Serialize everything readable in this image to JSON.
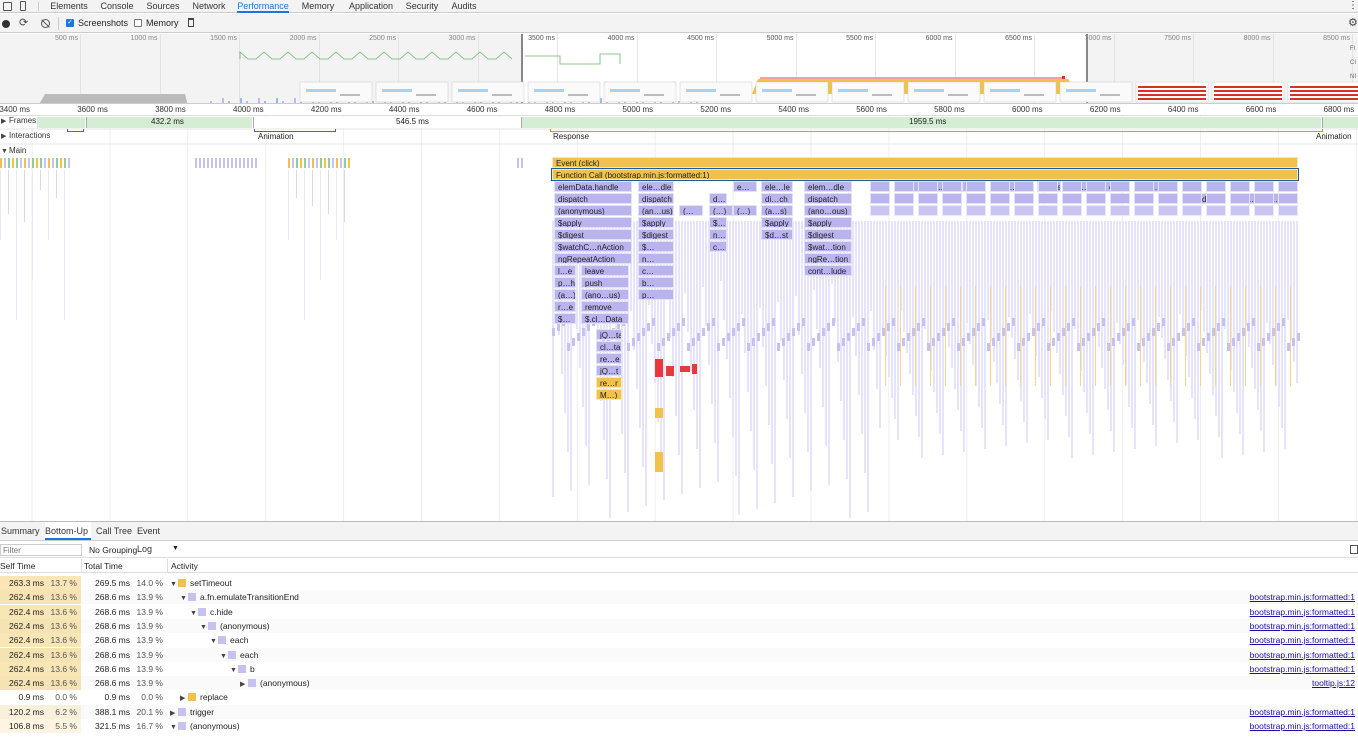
{
  "devtools": {
    "tabs": [
      "Elements",
      "Console",
      "Sources",
      "Network",
      "Performance",
      "Memory",
      "Application",
      "Security",
      "Audits"
    ],
    "active_tab": "Performance"
  },
  "toolbar": {
    "screenshots_label": "Screenshots",
    "screenshots_checked": true,
    "memory_label": "Memory",
    "memory_checked": false
  },
  "overview": {
    "ticks": [
      "500 ms",
      "1000 ms",
      "1500 ms",
      "2000 ms",
      "2500 ms",
      "3000 ms",
      "3500 ms",
      "4000 ms",
      "4500 ms",
      "5000 ms",
      "5500 ms",
      "6000 ms",
      "6500 ms",
      "7000 ms",
      "7500 ms",
      "8000 ms",
      "8500 ms"
    ],
    "side_labels": [
      "FI",
      "CI",
      "NI"
    ]
  },
  "ruler": {
    "ticks": [
      "3400 ms",
      "3600 ms",
      "3800 ms",
      "4000 ms",
      "4200 ms",
      "4400 ms",
      "4600 ms",
      "4800 ms",
      "5000 ms",
      "5200 ms",
      "5400 ms",
      "5600 ms",
      "5800 ms",
      "6000 ms",
      "6200 ms",
      "6400 ms",
      "6600 ms",
      "6800 ms"
    ]
  },
  "tracks": {
    "frames_label": "Frames",
    "frames_times": [
      "432.2 ms",
      "546.5 ms",
      "1959.5 ms"
    ],
    "interactions_label": "Interactions",
    "interactions": [
      "Animation",
      "Response",
      "Animation"
    ],
    "main_label": "Main"
  },
  "flame": {
    "event": "Event (click)",
    "function_call": "Function Call (bootstrap.min.js:formatted:1)",
    "col1": [
      "elemData.handle",
      "dispatch",
      "(anonymous)",
      "$apply",
      "$digest",
      "$watchC…nAction",
      "ngRepeatAction"
    ],
    "col1b": [
      "l…e",
      "p…h",
      "(a…)",
      "r…e",
      "$…"
    ],
    "col1c": [
      "leave",
      "push",
      "(ano…us)",
      "remove",
      "$.cl…Data"
    ],
    "col1d": [
      "jQ…ta",
      "cl…ta",
      "re…e",
      "jQ…t",
      "re…r",
      "M…)"
    ],
    "col2": [
      "ele…dle",
      "dispatch",
      "(an…us)",
      "$apply",
      "$digest",
      "$…",
      "n…",
      "c…",
      "b…",
      "p…"
    ],
    "col3": [
      "d…",
      "$…",
      "$…",
      "n…",
      "c…"
    ],
    "col4": [
      "ele…le",
      "di…ch",
      "(a…s)",
      "$apply",
      "$d…st"
    ],
    "col5": [
      "elem…dle",
      "dispatch",
      "(ano…ous)",
      "$apply",
      "$digest",
      "$wat…tion",
      "ngRe…tion",
      "cont…lude"
    ],
    "misc_labels": [
      "(…",
      "(…)",
      "(…)",
      "e…",
      "e…",
      "el…le",
      "e…",
      "e…",
      "el…le",
      "ele…",
      "e…",
      "e…",
      "d…",
      "d…h",
      "di…ch",
      "d…h",
      "di…ch",
      "di…ch",
      "d…h",
      "di…ch",
      "El…le"
    ]
  },
  "bottom": {
    "tabs": [
      "Summary",
      "Bottom-Up",
      "Call Tree",
      "Event Log"
    ],
    "active_tab": "Bottom-Up",
    "filter_placeholder": "Filter",
    "grouping": "No Grouping",
    "headers": {
      "self": "Self Time",
      "total": "Total Time",
      "activity": "Activity"
    },
    "rows": [
      {
        "self": "263.3 ms",
        "self_pct": "13.7 %",
        "total": "269.5 ms",
        "total_pct": "14.0 %",
        "indent": 0,
        "tri": "▼",
        "color": "#f0c14b",
        "name": "setTimeout",
        "link": "",
        "selfbar": 0.137
      },
      {
        "self": "262.4 ms",
        "self_pct": "13.6 %",
        "total": "268.6 ms",
        "total_pct": "13.9 %",
        "indent": 1,
        "tri": "▼",
        "color": "#c5c2f0",
        "name": "a.fn.emulateTransitionEnd",
        "link": "bootstrap.min.js:formatted:1",
        "selfbar": 0.136
      },
      {
        "self": "262.4 ms",
        "self_pct": "13.6 %",
        "total": "268.6 ms",
        "total_pct": "13.9 %",
        "indent": 2,
        "tri": "▼",
        "color": "#c5c2f0",
        "name": "c.hide",
        "link": "bootstrap.min.js:formatted:1",
        "selfbar": 0.136
      },
      {
        "self": "262.4 ms",
        "self_pct": "13.6 %",
        "total": "268.6 ms",
        "total_pct": "13.9 %",
        "indent": 3,
        "tri": "▼",
        "color": "#c5c2f0",
        "name": "(anonymous)",
        "link": "bootstrap.min.js:formatted:1",
        "selfbar": 0.136
      },
      {
        "self": "262.4 ms",
        "self_pct": "13.6 %",
        "total": "268.6 ms",
        "total_pct": "13.9 %",
        "indent": 4,
        "tri": "▼",
        "color": "#c5c2f0",
        "name": "each",
        "link": "bootstrap.min.js:formatted:1",
        "selfbar": 0.136
      },
      {
        "self": "262.4 ms",
        "self_pct": "13.6 %",
        "total": "268.6 ms",
        "total_pct": "13.9 %",
        "indent": 5,
        "tri": "▼",
        "color": "#c5c2f0",
        "name": "each",
        "link": "bootstrap.min.js:formatted:1",
        "selfbar": 0.136
      },
      {
        "self": "262.4 ms",
        "self_pct": "13.6 %",
        "total": "268.6 ms",
        "total_pct": "13.9 %",
        "indent": 6,
        "tri": "▼",
        "color": "#c5c2f0",
        "name": "b",
        "link": "bootstrap.min.js:formatted:1",
        "selfbar": 0.136
      },
      {
        "self": "262.4 ms",
        "self_pct": "13.6 %",
        "total": "268.6 ms",
        "total_pct": "13.9 %",
        "indent": 7,
        "tri": "▶",
        "color": "#c5c2f0",
        "name": "(anonymous)",
        "link": "tooltip.js:12",
        "selfbar": 0.136
      },
      {
        "self": "0.9 ms",
        "self_pct": "0.0 %",
        "total": "0.9 ms",
        "total_pct": "0.0 %",
        "indent": 1,
        "tri": "▶",
        "color": "#f0c14b",
        "name": "replace",
        "link": "",
        "selfbar": 0.0
      },
      {
        "self": "120.2 ms",
        "self_pct": "6.2 %",
        "total": "388.1 ms",
        "total_pct": "20.1 %",
        "indent": 0,
        "tri": "▶",
        "color": "#c5c2f0",
        "name": "trigger",
        "link": "bootstrap.min.js:formatted:1",
        "selfbar": 0.062
      },
      {
        "self": "106.8 ms",
        "self_pct": "5.5 %",
        "total": "321.5 ms",
        "total_pct": "16.7 %",
        "indent": 0,
        "tri": "▼",
        "color": "#c5c2f0",
        "name": "(anonymous)",
        "link": "bootstrap.min.js:formatted:1",
        "selfbar": 0.055
      }
    ]
  }
}
